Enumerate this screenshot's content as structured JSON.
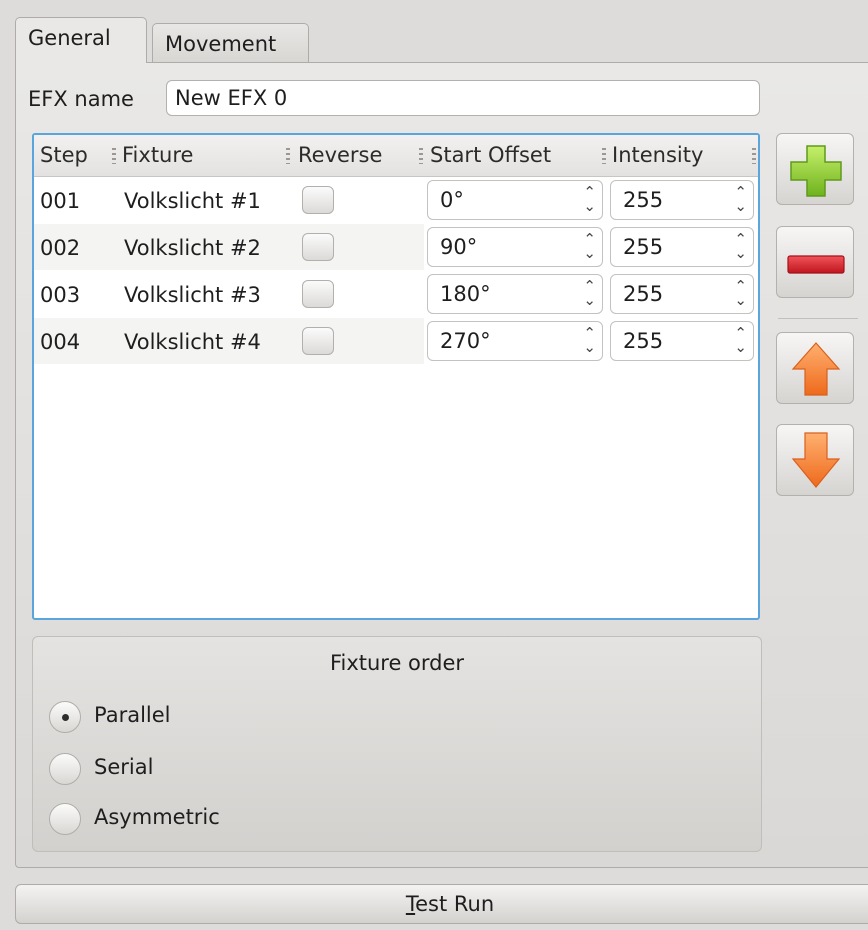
{
  "tabs": [
    {
      "label": "General",
      "active": true
    },
    {
      "label": "Movement",
      "active": false
    }
  ],
  "efx": {
    "name_label": "EFX name",
    "name_value": "New EFX 0"
  },
  "table": {
    "headers": [
      "Step",
      "Fixture",
      "Reverse",
      "Start Offset",
      "Intensity"
    ],
    "rows": [
      {
        "step": "001",
        "fixture": "Volkslicht #1",
        "reverse": false,
        "offset": "0°",
        "intensity": "255"
      },
      {
        "step": "002",
        "fixture": "Volkslicht #2",
        "reverse": false,
        "offset": "90°",
        "intensity": "255"
      },
      {
        "step": "003",
        "fixture": "Volkslicht #3",
        "reverse": false,
        "offset": "180°",
        "intensity": "255"
      },
      {
        "step": "004",
        "fixture": "Volkslicht #4",
        "reverse": false,
        "offset": "270°",
        "intensity": "255"
      }
    ]
  },
  "side_buttons": [
    {
      "icon": "add-icon"
    },
    {
      "icon": "remove-icon"
    },
    {
      "icon": "arrow-up-icon"
    },
    {
      "icon": "arrow-down-icon"
    }
  ],
  "fixture_order": {
    "title": "Fixture order",
    "options": [
      {
        "label": "Parallel",
        "selected": true
      },
      {
        "label": "Serial",
        "selected": false
      },
      {
        "label": "Asymmetric",
        "selected": false
      }
    ]
  },
  "test_run": {
    "label_mnemonic": "T",
    "label_rest": "est Run"
  },
  "colors": {
    "focus_border": "#5aa5db",
    "add_green": "#8ccc2e",
    "remove_red": "#d9252e",
    "arrow_orange": "#f07a2a"
  }
}
